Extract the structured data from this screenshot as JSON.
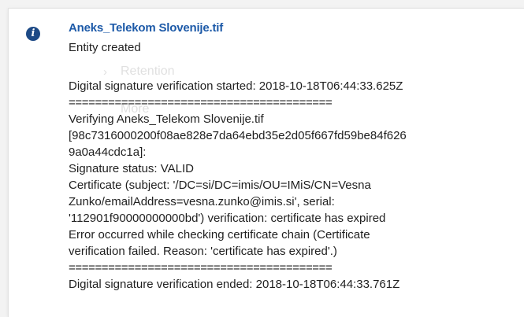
{
  "notification": {
    "icon": "info-circle-icon",
    "title": "Aneks_Telekom Slovenije.tif",
    "subtitle": "Entity created",
    "background_items": [
      "Retention",
      "More"
    ],
    "log_lines": [
      "Digital signature verification started: 2018-10-18T06:44:33.625Z",
      "========================================",
      "Verifying Aneks_Telekom Slovenije.tif",
      "[98c7316000200f08ae828e7da64ebd35e2d05f667fd59be84f626",
      "9a0a44cdc1a]:",
      "Signature status: VALID",
      "Certificate (subject: '/DC=si/DC=imis/OU=IMiS/CN=Vesna",
      "Zunko/emailAddress=vesna.zunko@imis.si', serial:",
      "'112901f90000000000bd') verification: certificate has expired",
      "Error occurred while checking certificate chain (Certificate",
      "verification failed. Reason: 'certificate has expired'.)",
      "========================================",
      "Digital signature verification ended: 2018-10-18T06:44:33.761Z"
    ]
  }
}
